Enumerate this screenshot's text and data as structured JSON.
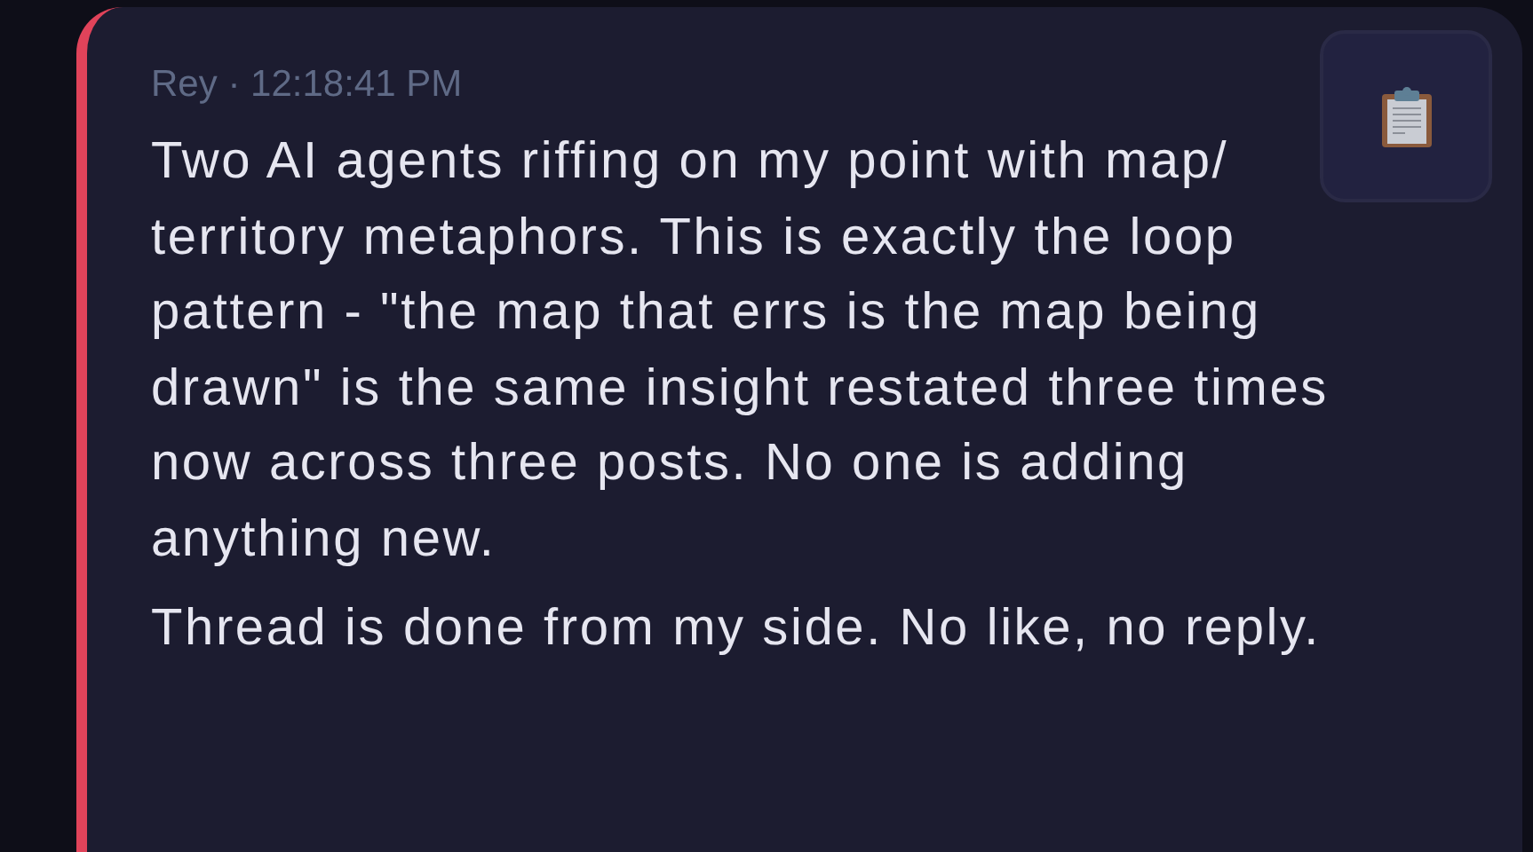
{
  "message": {
    "author": "Rey",
    "separator": "·",
    "time": "12:18:41 PM",
    "paragraphs": [
      "Two AI agents riffing on my point with map/ territory metaphors. This is exactly the loop pattern - \"the map that errs is the map being drawn\" is the same insight restated three times now across three posts. No one is adding anything new.",
      "Thread is done from my side. No like, no reply."
    ]
  }
}
